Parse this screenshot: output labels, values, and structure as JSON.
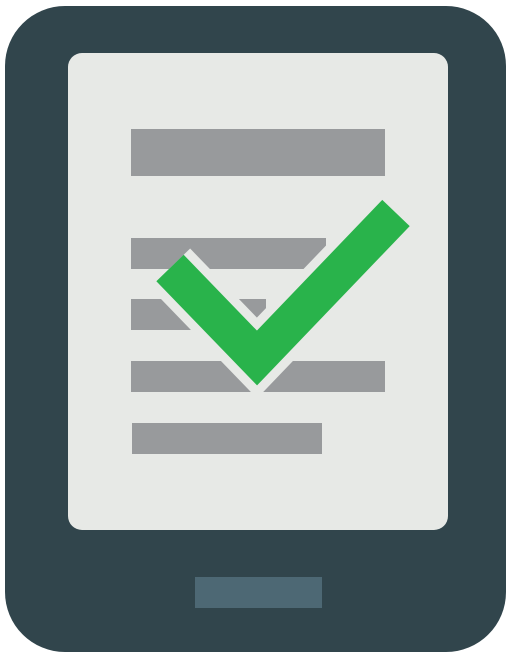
{
  "icon": {
    "semantic": "tablet-document-checkmark-icon",
    "parts": [
      "tablet-body",
      "tablet-screen",
      "document-lines",
      "checkmark",
      "home-button"
    ]
  },
  "colors": {
    "tablet_body": "#31454C",
    "screen": "#E7E9E6",
    "document_line": "#989A9C",
    "checkmark": "#29B34B",
    "checkmark_outline": "#E7E9E6",
    "home_button": "#4D6874"
  }
}
